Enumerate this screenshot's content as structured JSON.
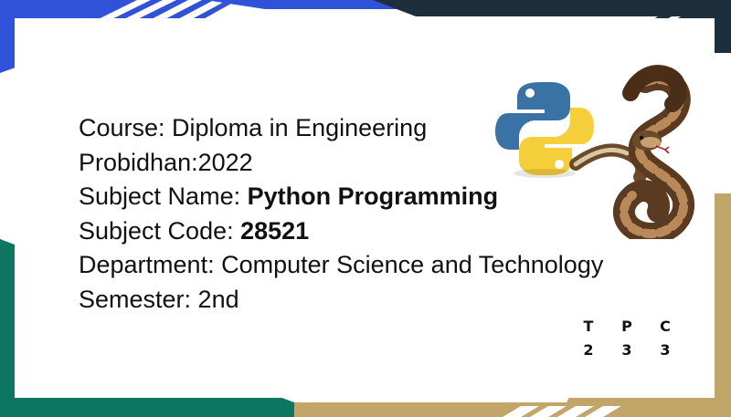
{
  "slide": {
    "lines": [
      {
        "label": "Course: ",
        "value": "Diploma in Engineering",
        "value_bold": false
      },
      {
        "label": "Probidhan:",
        "value": "2022",
        "value_bold": false
      },
      {
        "label": "Subject Name: ",
        "value": "Python Programming",
        "value_bold": true
      },
      {
        "label": "Subject Code: ",
        "value": "28521",
        "value_bold": true
      },
      {
        "label": "Department: ",
        "value": "Computer Science and Technology",
        "value_bold": false
      },
      {
        "label": "Semester: ",
        "value": "2nd",
        "value_bold": false
      }
    ],
    "tpc": {
      "headers": [
        "T",
        "P",
        "C"
      ],
      "values": [
        "2",
        "3",
        "3"
      ]
    }
  },
  "colors": {
    "blue_accent": "#2f52d8",
    "navy_accent": "#1d2f3d",
    "teal_accent": "#0d7560",
    "tan_accent": "#c2a568",
    "python_blue": "#3a72a6",
    "python_yellow": "#f5cf3b"
  },
  "graphics": {
    "python_logo": "python-logo",
    "snake": "ball-python-snake"
  }
}
